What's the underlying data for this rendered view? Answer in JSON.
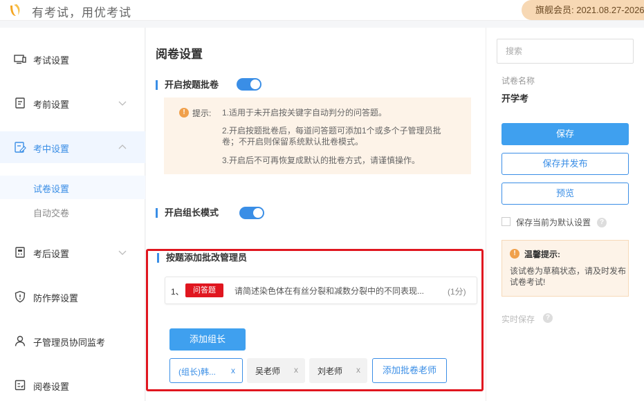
{
  "header": {
    "brand_text": "有考试，用优考试",
    "member_badge": "旗舰会员: 2021.08.27-2026"
  },
  "sidebar": {
    "items": [
      {
        "label": "考试设置",
        "icon": "monitor-icon"
      },
      {
        "label": "考前设置",
        "icon": "document-icon"
      },
      {
        "label": "考中设置",
        "icon": "edit-document-icon"
      },
      {
        "label": "考后设置",
        "icon": "calculator-icon"
      },
      {
        "label": "防作弊设置",
        "icon": "shield-icon"
      },
      {
        "label": "子管理员协同监考",
        "icon": "user-icon"
      },
      {
        "label": "阅卷设置",
        "icon": "checklist-icon"
      }
    ],
    "sub_items": [
      "试卷设置",
      "自动交卷"
    ]
  },
  "main": {
    "page_title": "阅卷设置",
    "section1_title": "开启按题批卷",
    "tip": {
      "label": "提示:",
      "line1": "1.适用于未开启按关键字自动判分的问答题。",
      "line2": "2.开启按题批卷后，每道问答题可添加1个或多个子管理员批卷；不开启则保留系统默认批卷模式。",
      "line3": "3.开启后不可再恢复成默认的批卷方式，请谨慎操作。"
    },
    "section2_title": "开启组长模式",
    "section3_title": "按题添加批改管理员",
    "question": {
      "number": "1、",
      "tag": "问答题",
      "text": "请简述染色体在有丝分裂和减数分裂中的不同表现...",
      "score": "(1分)"
    },
    "add_leader_label": "添加组长",
    "chips": [
      {
        "label": "(组长)韩...",
        "close": "x"
      },
      {
        "label": "吴老师",
        "close": "x"
      },
      {
        "label": "刘老师",
        "close": "x"
      }
    ],
    "add_teacher_label": "添加批卷老师"
  },
  "right": {
    "search_placeholder": "搜索",
    "paper_label": "试卷名称",
    "paper_name": "开学考",
    "save_label": "保存",
    "save_publish_label": "保存并发布",
    "preview_label": "预览",
    "default_label": "保存当前为默认设置",
    "warm_title": "温馨提示:",
    "warm_body": "该试卷为草稿状态，请及时发布试卷考试!",
    "realtime_label": "实时保存"
  },
  "colors": {
    "accent": "#3a8ee6",
    "button_primary": "#3fa0ef",
    "highlight_frame": "#e0161f",
    "tip_background": "#fdf3e8",
    "member_badge": "#f7d8b4"
  }
}
